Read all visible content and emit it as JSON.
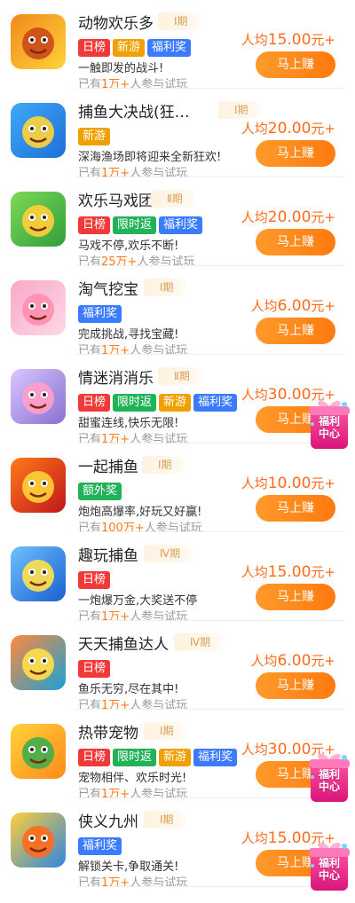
{
  "reward_prefix": "人均",
  "reward_suffix": "元+",
  "button_label": "马上赚",
  "players_prefix": "已有",
  "players_suffix": "人参与试玩",
  "float_badge": {
    "line1": "福利",
    "line2": "中心"
  },
  "colors": {
    "accent": "#ff7a10",
    "tag_日榜": "#f03a3a",
    "tag_新游": "#f0a000",
    "tag_福利奖": "#3a7bff",
    "tag_限时返": "#22b35a",
    "tag_额外奖": "#22b35a"
  },
  "games": [
    {
      "name": "动物欢乐多",
      "phase": "Ⅰ期",
      "tags": [
        "日榜",
        "新游",
        "福利奖"
      ],
      "desc": "一触即发的战斗!",
      "count": "1万+",
      "reward": "15.00",
      "icon": "lion-king-icon"
    },
    {
      "name": "捕鱼大决战(狂…",
      "phase": "Ⅰ期",
      "tags": [
        "新游"
      ],
      "desc": "深海渔场即将迎来全新狂欢!",
      "count": "1万+",
      "reward": "20.00",
      "icon": "shark-icon"
    },
    {
      "name": "欢乐马戏团",
      "phase": "Ⅱ期",
      "tags": [
        "日榜",
        "限时返",
        "福利奖"
      ],
      "desc": "马戏不停,欢乐不断!",
      "count": "25万+",
      "reward": "20.00",
      "icon": "frog-icon"
    },
    {
      "name": "淘气挖宝",
      "phase": "Ⅰ期",
      "tags": [
        "福利奖"
      ],
      "desc": "完成挑战,寻找宝藏!",
      "count": "1万+",
      "reward": "6.00",
      "icon": "pig-icon"
    },
    {
      "name": "情迷消消乐",
      "phase": "Ⅱ期",
      "tags": [
        "日榜",
        "限时返",
        "新游",
        "福利奖"
      ],
      "desc": "甜蜜连线,快乐无限!",
      "count": "1万+",
      "reward": "30.00",
      "icon": "anime-girl-icon"
    },
    {
      "name": "一起捕鱼",
      "phase": "Ⅰ期",
      "tags": [
        "额外奖"
      ],
      "desc": "炮炮高爆率,好玩又好赢!",
      "count": "100万+",
      "reward": "10.00",
      "icon": "golden-dragon-icon"
    },
    {
      "name": "趣玩捕鱼",
      "phase": "Ⅳ期",
      "tags": [
        "日榜"
      ],
      "desc": "一炮爆万金,大奖送不停",
      "count": "1万+",
      "reward": "15.00",
      "icon": "shark-3d-icon"
    },
    {
      "name": "天天捕鱼达人",
      "phase": "Ⅳ期",
      "tags": [
        "日榜"
      ],
      "desc": "鱼乐无穷,尽在其中!",
      "count": "1万+",
      "reward": "6.00",
      "icon": "cartoon-fish-icon"
    },
    {
      "name": "热带宠物",
      "phase": "Ⅰ期",
      "tags": [
        "日榜",
        "限时返",
        "新游",
        "福利奖"
      ],
      "desc": "宠物相伴、欢乐时光!",
      "count": "1万+",
      "reward": "30.00",
      "icon": "fox-icon"
    },
    {
      "name": "侠义九州",
      "phase": "Ⅰ期",
      "tags": [
        "福利奖"
      ],
      "desc": "解锁关卡,争取通关!",
      "count": "1万+",
      "reward": "15.00",
      "icon": "lion-hero-icon"
    }
  ]
}
